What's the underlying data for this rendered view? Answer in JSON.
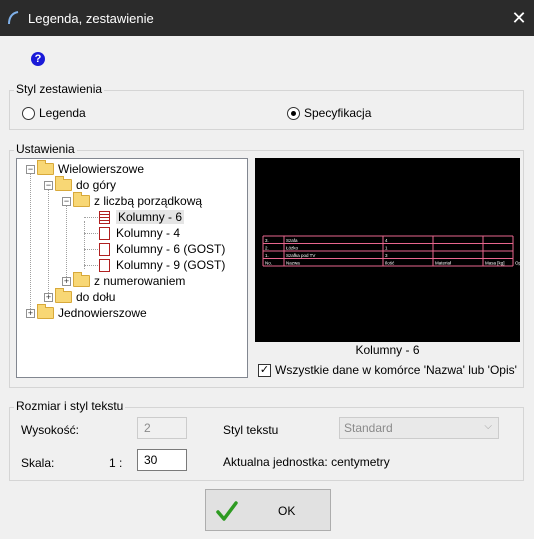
{
  "window": {
    "title": "Legenda, zestawienie",
    "close_glyph": "✕",
    "help_glyph": "?"
  },
  "styl": {
    "group_label": "Styl zestawienia",
    "options": [
      {
        "label": "Legenda",
        "selected": false
      },
      {
        "label": "Specyfikacja",
        "selected": true
      }
    ]
  },
  "ustawienia": {
    "group_label": "Ustawienia",
    "tree": {
      "n0": "Wielowierszowe",
      "n1": "do góry",
      "n2": "z liczbą porządkową",
      "n3": "Kolumny - 6",
      "n4": "Kolumny - 4",
      "n5": "Kolumny - 6 (GOST)",
      "n6": "Kolumny - 9 (GOST)",
      "n7": "z numerowaniem",
      "n8": "do dołu",
      "n9": "Jednowierszowe",
      "selected": "Kolumny - 6"
    },
    "preview": {
      "caption": "Kolumny - 6",
      "rows": [
        [
          "3.",
          "Szafa",
          "4",
          "",
          "",
          ""
        ],
        [
          "2.",
          "Łóżko",
          "1",
          "",
          "",
          ""
        ],
        [
          "1.",
          "Szafka pod TV",
          "3",
          "",
          "",
          ""
        ],
        [
          "No.",
          "Nazwa",
          "Ilość",
          "Materiał",
          "Masa [kg]",
          "Opis"
        ]
      ],
      "line_color": "#e8668e",
      "text_color": "#ffffff"
    },
    "checkbox": {
      "label": "Wszystkie dane w komórce 'Nazwa' lub 'Opis'",
      "checked": true
    }
  },
  "rozmiar": {
    "group_label": "Rozmiar i styl tekstu",
    "wysokosc_label": "Wysokość:",
    "wysokosc_value": "2",
    "skala_label": "Skala:",
    "skala_prefix": "1 :",
    "skala_value": "30",
    "styl_label": "Styl tekstu",
    "styl_value": "Standard",
    "jednostka": "Aktualna jednostka: centymetry"
  },
  "ok_label": "OK",
  "colors": {
    "titlebar": "#2b2b2b",
    "ok_check": "#2e9b22"
  }
}
